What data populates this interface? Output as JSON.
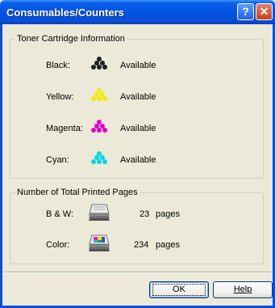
{
  "window": {
    "title": "Consumables/Counters",
    "help_glyph": "?",
    "close_glyph": "✕"
  },
  "toner_group": {
    "title": "Toner Cartridge Information",
    "rows": [
      {
        "label": "Black:",
        "status": "Available",
        "color": "#202020"
      },
      {
        "label": "Yellow:",
        "status": "Available",
        "color": "#f2ea00"
      },
      {
        "label": "Magenta:",
        "status": "Available",
        "color": "#e000c8"
      },
      {
        "label": "Cyan:",
        "status": "Available",
        "color": "#00d8e8"
      }
    ]
  },
  "pages_group": {
    "title": "Number of Total Printed Pages",
    "rows": [
      {
        "label": "B & W:",
        "count": "23",
        "unit": "pages",
        "icon": "bw-printer-icon"
      },
      {
        "label": "Color:",
        "count": "234",
        "unit": "pages",
        "icon": "color-printer-icon"
      }
    ]
  },
  "buttons": {
    "ok": "OK",
    "help": "Help"
  }
}
